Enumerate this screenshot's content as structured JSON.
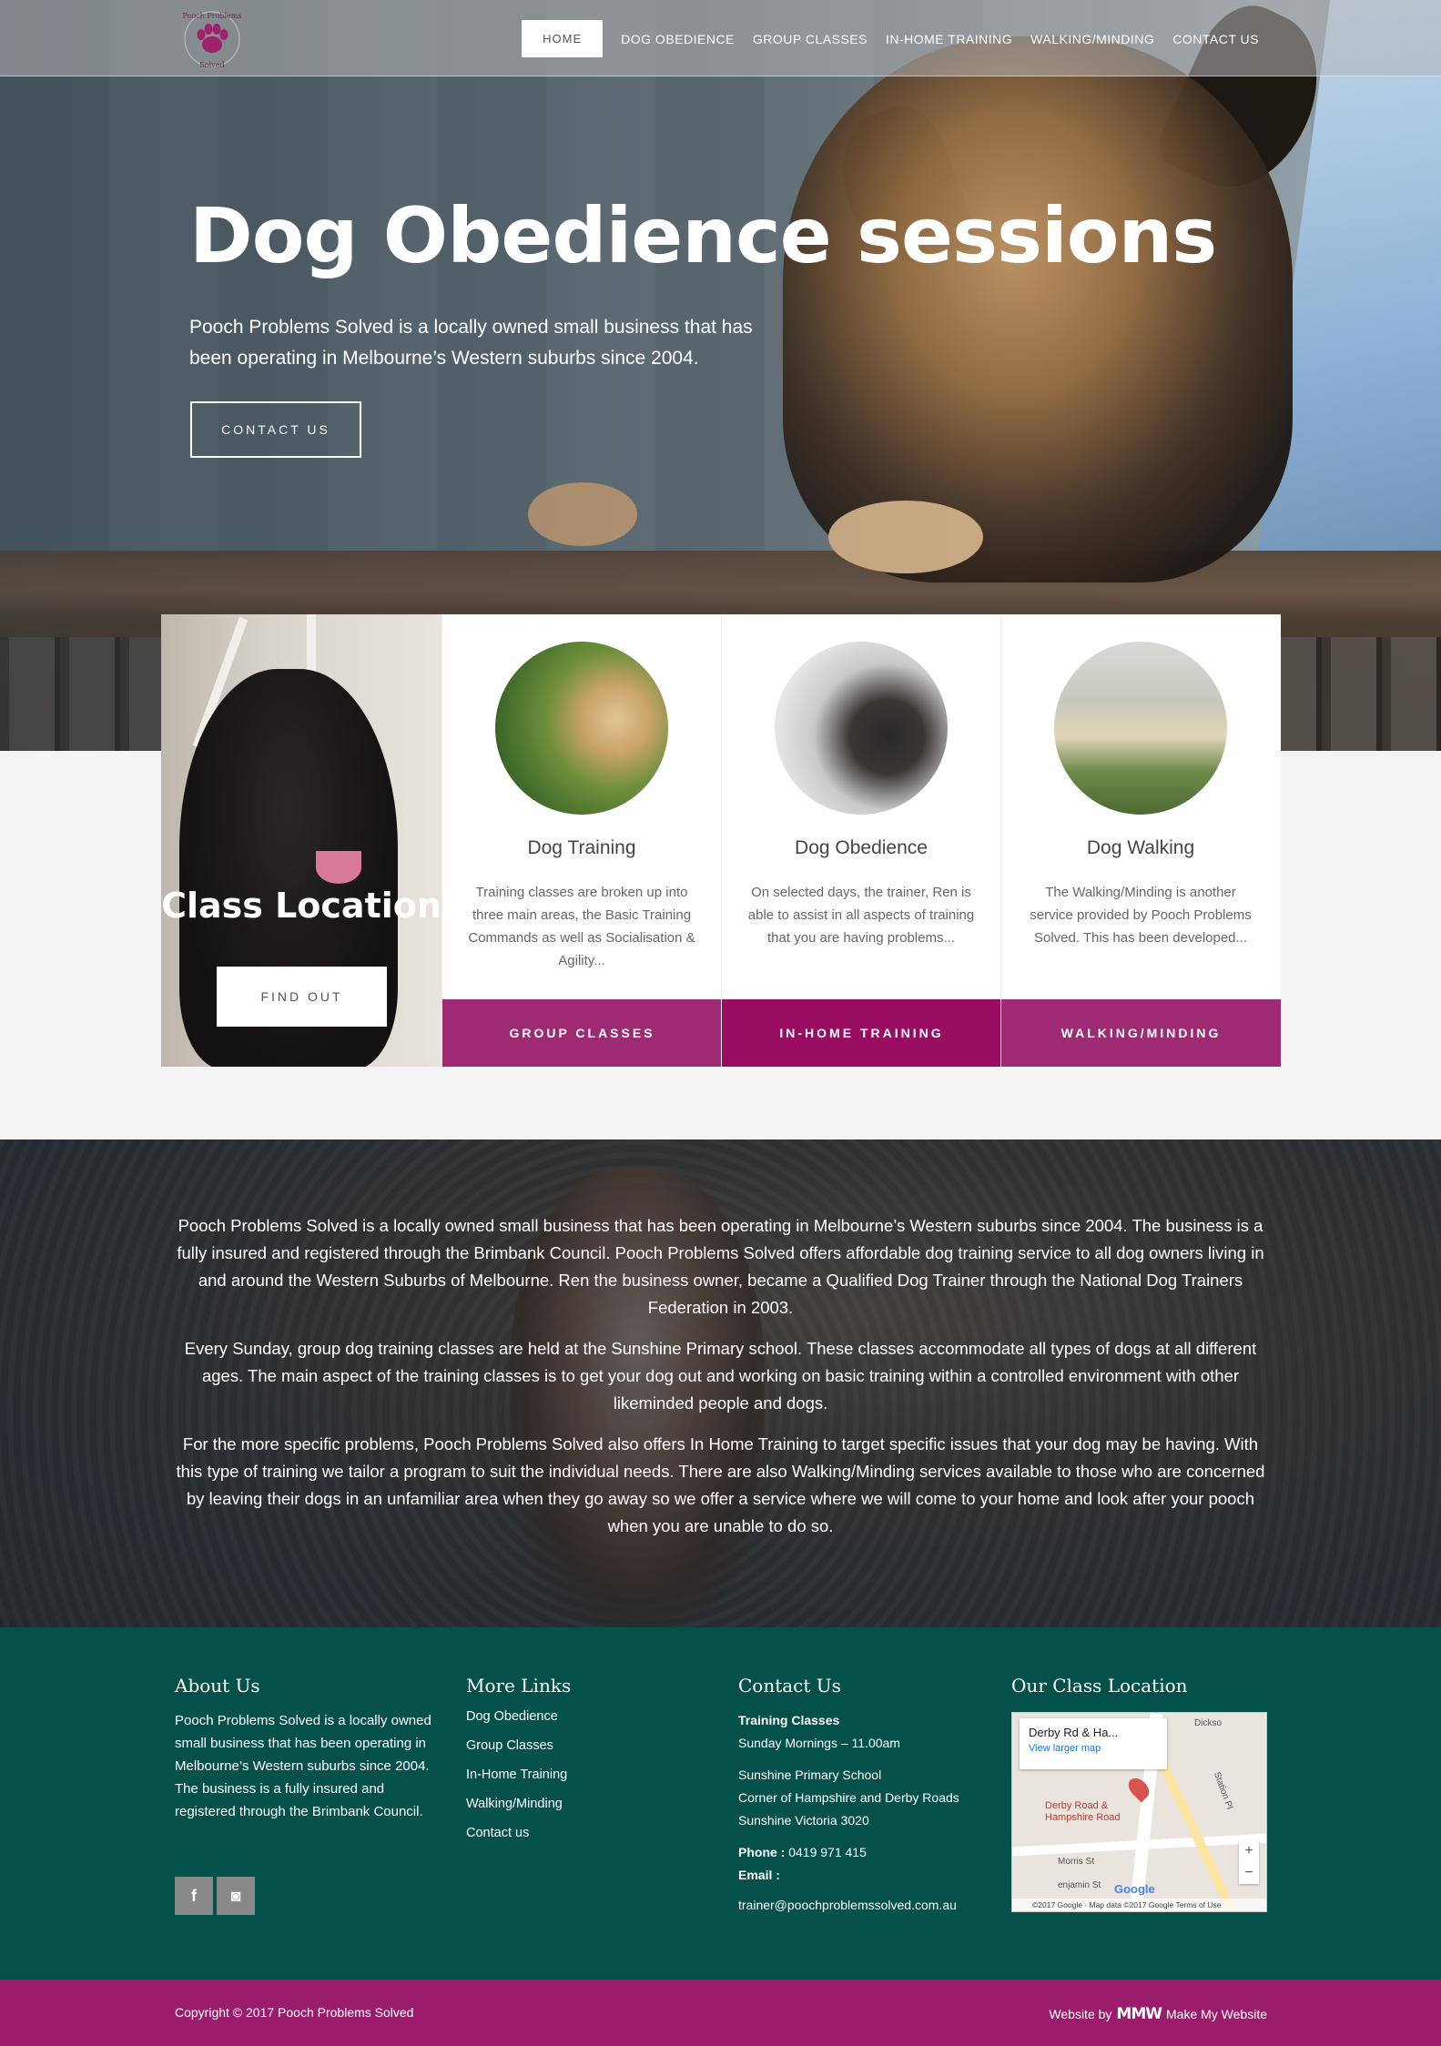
{
  "brand": {
    "logo_text_top": "Pooch Problems",
    "logo_text_bottom": "Solved",
    "accent": "#9b1c6c",
    "footer_bg": "#04504b"
  },
  "nav": {
    "items": [
      {
        "label": "HOME",
        "active": true
      },
      {
        "label": "DOG OBEDIENCE"
      },
      {
        "label": "GROUP CLASSES"
      },
      {
        "label": "IN-HOME TRAINING"
      },
      {
        "label": "WALKING/MINDING"
      },
      {
        "label": "CONTACT US"
      }
    ]
  },
  "hero": {
    "title": "Dog Obedience sessions",
    "subtitle": "Pooch Problems Solved is a locally owned small business that has been operating in Melbourne’s Western suburbs since 2004.",
    "button": "CONTACT US"
  },
  "location_card": {
    "title": "Class Location",
    "button": "FIND OUT"
  },
  "services": [
    {
      "title": "Dog Training",
      "text": "Training classes are broken up into three main areas, the Basic Training Commands as well as Socialisation & Agility...",
      "bar": "GROUP CLASSES",
      "bar_color": "#9d2a72"
    },
    {
      "title": "Dog Obedience",
      "text": "On selected days, the trainer, Ren is able to assist in all aspects of training that you are having problems...",
      "bar": "IN-HOME TRAINING",
      "bar_color": "#980d62"
    },
    {
      "title": "Dog Walking",
      "text": "The Walking/Minding is another service provided by Pooch Problems Solved. This has been developed...",
      "bar": "WALKING/MINDING",
      "bar_color": "#9d2a72"
    }
  ],
  "about": {
    "paragraphs": [
      "Pooch Problems Solved is a locally owned small business that has been operating in Melbourne’s Western suburbs since 2004. The business is a fully insured and registered through the Brimbank Council. Pooch Problems Solved offers affordable dog training service to all dog owners living in and around the Western Suburbs of Melbourne. Ren the business owner, became a Qualified Dog Trainer through the National Dog Trainers Federation in 2003.",
      "Every Sunday, group dog training classes are held at the Sunshine Primary school. These classes accommodate all types of dogs at all different ages. The main aspect of the training classes is to get your dog out and working on basic training within a controlled environment with other likeminded people and dogs.",
      "For the more specific problems, Pooch Problems Solved also offers In Home Training to target specific issues that your dog may be having. With this type of training we tailor a program to suit the individual needs. There are also Walking/Minding services available to those who are concerned by leaving their dogs in an unfamiliar area when they go away so we offer a service where we will come to your home and look after your pooch when you are unable to do so."
    ]
  },
  "footer": {
    "about": {
      "title": "About Us",
      "text": "Pooch Problems Solved is a locally owned small business that has been operating in Melbourne’s Western suburbs since 2004. The business is a fully insured and registered through the Brimbank Council."
    },
    "social": [
      {
        "icon": "facebook-icon",
        "glyph": "f"
      },
      {
        "icon": "instagram-icon",
        "glyph": "◙"
      }
    ],
    "links": {
      "title": "More Links",
      "items": [
        "Dog Obedience",
        "Group Classes",
        "In-Home Training",
        "Walking/Minding",
        "Contact us"
      ]
    },
    "contact": {
      "title": "Contact Us",
      "classes_label": "Training Classes",
      "classes_time": "Sunday Mornings – 11.00am",
      "venue": "Sunshine Primary School",
      "address1": "Corner of Hampshire and Derby Roads",
      "address2": "Sunshine Victoria 3020",
      "phone_label": "Phone :",
      "phone": "0419 971 415",
      "email_label": "Email :",
      "email": "trainer@poochproblemssolved.com.au"
    },
    "map": {
      "title": "Our Class Location",
      "popup_title": "Derby Rd & Ha...",
      "popup_link": "View larger map",
      "pin_label_1": "Derby Road &",
      "pin_label_2": "Hampshire Road",
      "street_1": "Dickso",
      "street_2": "Station Pl",
      "street_3": "Morris St",
      "street_4": "enjamin St",
      "attribution": "©2017 Google · Map data ©2017 Google    Terms of Use",
      "logo": "Google",
      "zoom_in": "+",
      "zoom_out": "−"
    }
  },
  "copyright": {
    "text": "Copyright © 2017 Pooch Problems Solved",
    "credit_prefix": "Website by",
    "credit_logo": "MMW",
    "credit_name": "Make My Website"
  }
}
